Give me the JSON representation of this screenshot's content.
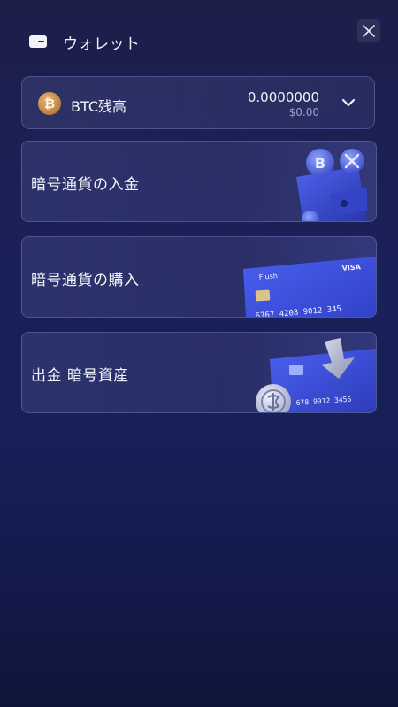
{
  "header": {
    "title": "ウォレット",
    "wallet_icon": "wallet-icon",
    "close_icon": "close-icon"
  },
  "balance": {
    "currency_label": "BTC残高",
    "coin_symbol": "₿",
    "amount": "0.0000000",
    "fiat": "$0.00",
    "expand_icon": "chevron-down-icon"
  },
  "actions": [
    {
      "label": "暗号通貨の入金",
      "art": "crypto-wallet-illustration"
    },
    {
      "label": "暗号通貨の購入",
      "art": "credit-card-illustration",
      "card_brand": "Flush",
      "card_network": "VISA",
      "card_number": "6767 4208 9012 345"
    },
    {
      "label": "出金 暗号資産",
      "art": "withdraw-illustration",
      "card_number": "678 9012 3456"
    }
  ],
  "colors": {
    "background": "#1b2058",
    "card_border": "#8c96dc",
    "btc_coin": "#c48a45",
    "accent_blue": "#3b4fd8"
  }
}
